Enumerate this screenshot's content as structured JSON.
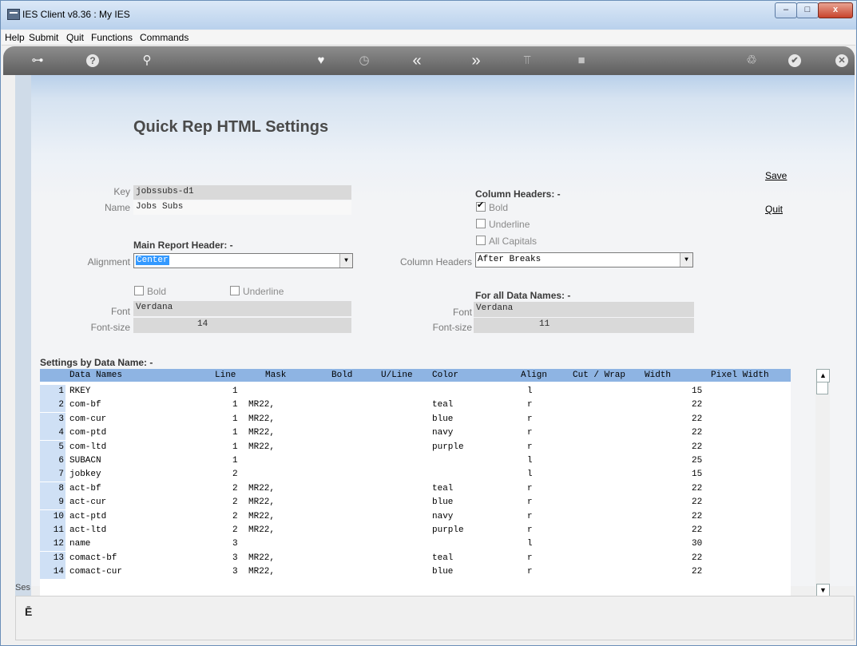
{
  "window": {
    "title": "IES Client v8.36 : My IES",
    "min": "–",
    "max": "□",
    "close": "x"
  },
  "menu": [
    "Help",
    "Submit",
    "Quit",
    "Functions",
    "Commands"
  ],
  "toolbar": {
    "key": "⊶",
    "help": "?",
    "search": "⚲",
    "favorite": "♥",
    "history": "◷",
    "back": "«",
    "forward": "»",
    "tools": "⫪",
    "stop": "■",
    "refresh": "♲",
    "ok": "✔",
    "exit": "✕"
  },
  "page": {
    "title": "Quick Rep HTML Settings"
  },
  "actions": {
    "save": "Save",
    "quit": "Quit"
  },
  "form": {
    "key_label": "Key",
    "key_value": "jobssubs-d1",
    "name_label": "Name",
    "name_value": "Jobs Subs",
    "main_header_title": "Main Report Header: -",
    "alignment_label": "Alignment",
    "alignment_value": "Center",
    "main_bold": "Bold",
    "main_underline": "Underline",
    "main_font_label": "Font",
    "main_font_value": "Verdana",
    "main_fontsize_label": "Font-size",
    "main_fontsize_value": "14",
    "col_headers_title": "Column Headers: -",
    "col_bold": "Bold",
    "col_underline": "Underline",
    "col_caps": "All Capitals",
    "col_headers_label": "Column Headers",
    "col_headers_value": "After Breaks",
    "data_names_title": "For all Data Names: -",
    "data_font_label": "Font",
    "data_font_value": "Verdana",
    "data_fontsize_label": "Font-size",
    "data_fontsize_value": "11"
  },
  "grid": {
    "title": "Settings by Data Name: -",
    "columns": [
      "Data Names",
      "Line",
      "Mask",
      "Bold",
      "U/Line",
      "Color",
      "Align",
      "Cut / Wrap",
      "Width",
      "Pixel Width"
    ],
    "rows": [
      {
        "n": "1",
        "name": "RKEY",
        "line": "1",
        "mask": "",
        "color": "",
        "align": "l",
        "width": "15"
      },
      {
        "n": "2",
        "name": "com-bf",
        "line": "1",
        "mask": "MR22,",
        "color": "teal",
        "align": "r",
        "width": "22"
      },
      {
        "n": "3",
        "name": "com-cur",
        "line": "1",
        "mask": "MR22,",
        "color": "blue",
        "align": "r",
        "width": "22"
      },
      {
        "n": "4",
        "name": "com-ptd",
        "line": "1",
        "mask": "MR22,",
        "color": "navy",
        "align": "r",
        "width": "22"
      },
      {
        "n": "5",
        "name": "com-ltd",
        "line": "1",
        "mask": "MR22,",
        "color": "purple",
        "align": "r",
        "width": "22"
      },
      {
        "n": "6",
        "name": "SUBACN",
        "line": "1",
        "mask": "",
        "color": "",
        "align": "l",
        "width": "25"
      },
      {
        "n": "7",
        "name": "jobkey",
        "line": "2",
        "mask": "",
        "color": "",
        "align": "l",
        "width": "15"
      },
      {
        "n": "8",
        "name": "act-bf",
        "line": "2",
        "mask": "MR22,",
        "color": "teal",
        "align": "r",
        "width": "22"
      },
      {
        "n": "9",
        "name": "act-cur",
        "line": "2",
        "mask": "MR22,",
        "color": "blue",
        "align": "r",
        "width": "22"
      },
      {
        "n": "10",
        "name": "act-ptd",
        "line": "2",
        "mask": "MR22,",
        "color": "navy",
        "align": "r",
        "width": "22"
      },
      {
        "n": "11",
        "name": "act-ltd",
        "line": "2",
        "mask": "MR22,",
        "color": "purple",
        "align": "r",
        "width": "22"
      },
      {
        "n": "12",
        "name": "name",
        "line": "3",
        "mask": "",
        "color": "",
        "align": "l",
        "width": "30"
      },
      {
        "n": "13",
        "name": "comact-bf",
        "line": "3",
        "mask": "MR22,",
        "color": "teal",
        "align": "r",
        "width": "22"
      },
      {
        "n": "14",
        "name": "comact-cur",
        "line": "3",
        "mask": "MR22,",
        "color": "blue",
        "align": "r",
        "width": "22"
      }
    ]
  },
  "scroll": {
    "up": "▲",
    "down": "▼"
  },
  "status": {
    "ses": "Ses",
    "bottom_glyph": "Ē"
  }
}
